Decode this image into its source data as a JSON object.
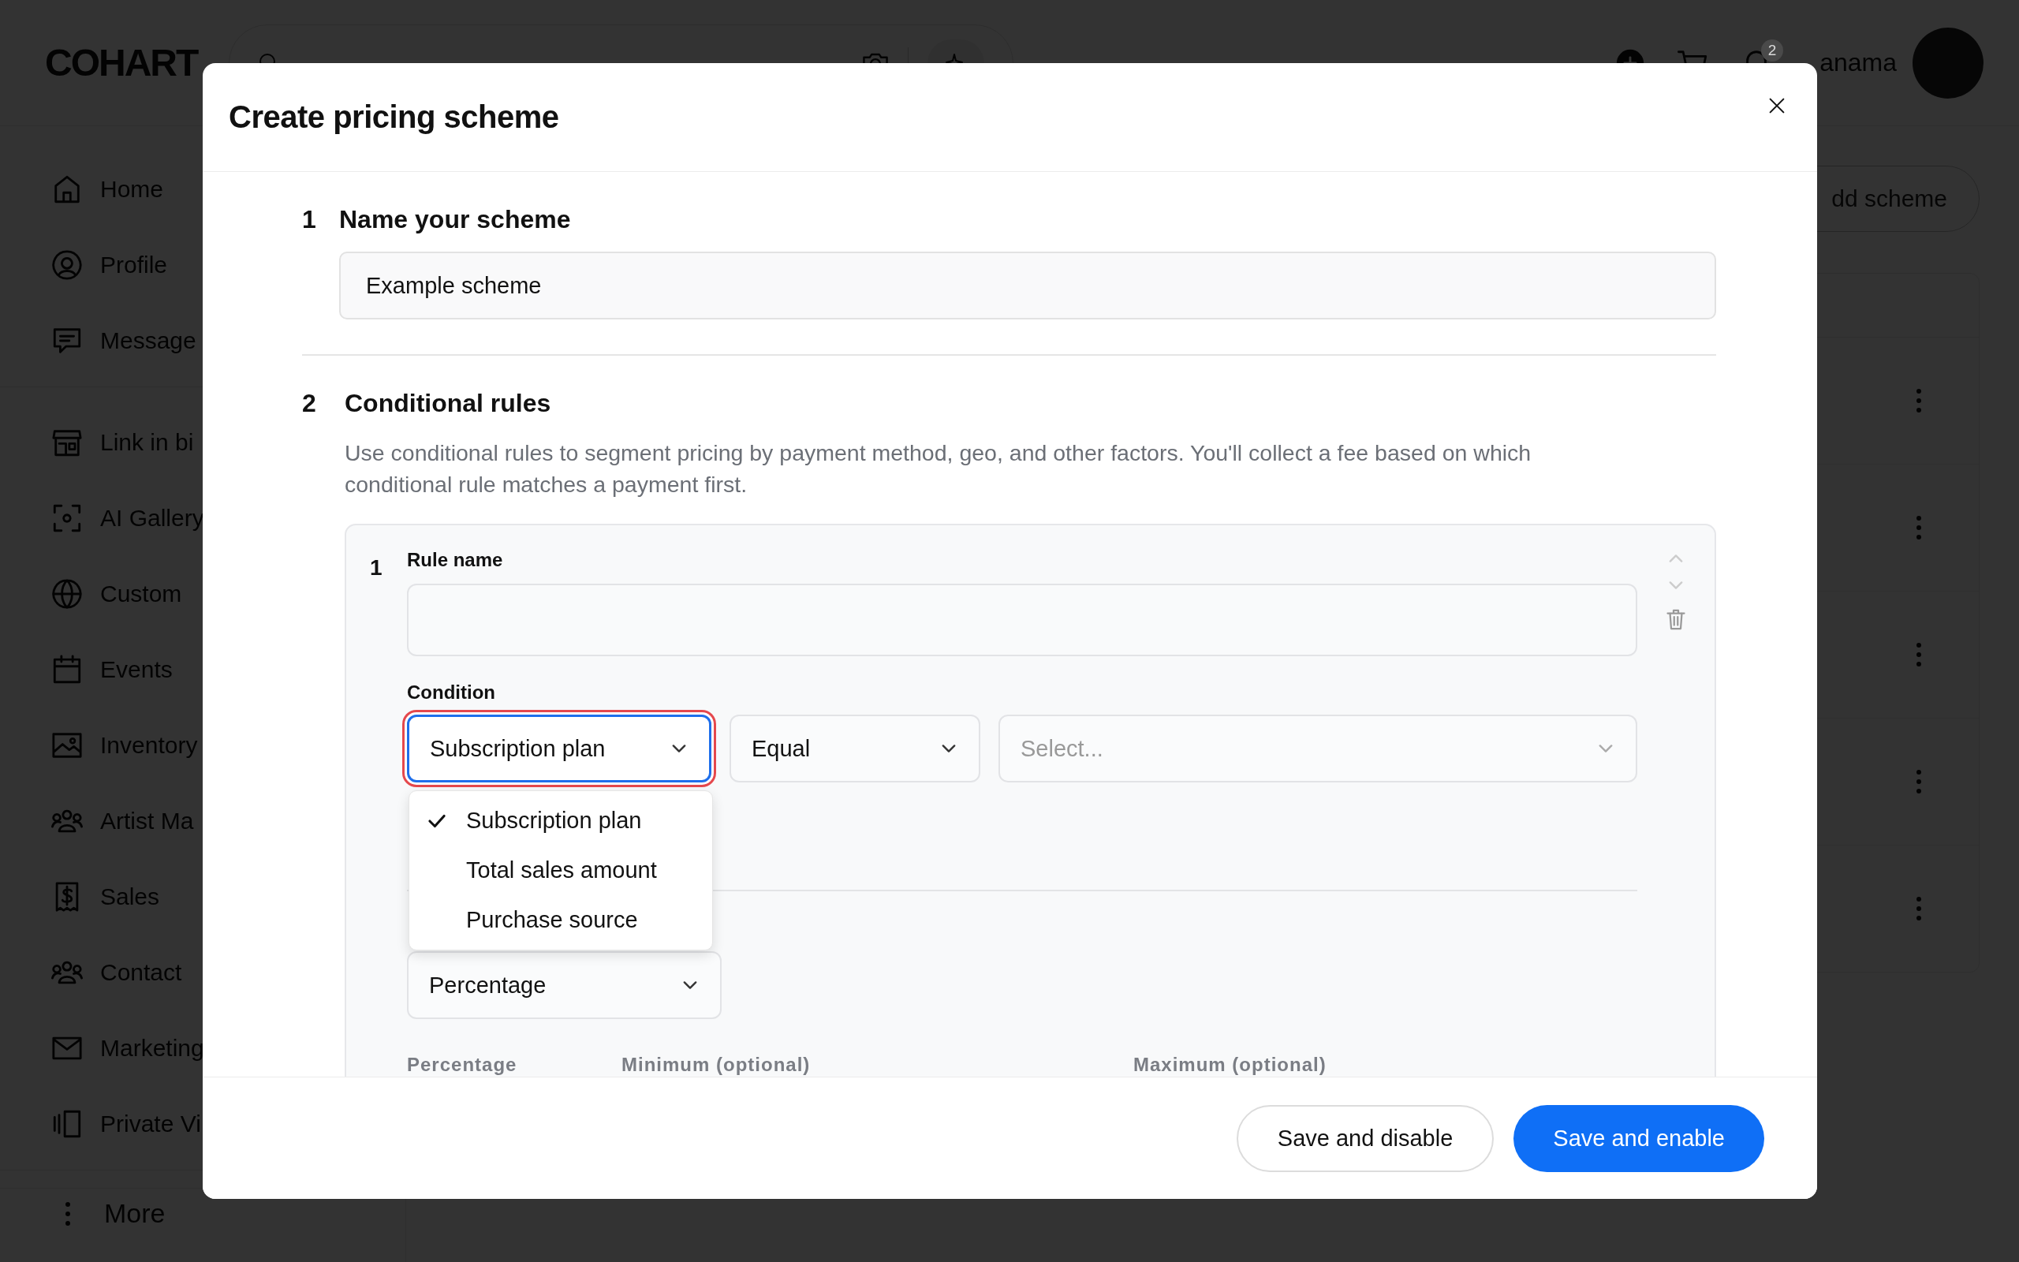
{
  "topbar": {
    "logo": "COHART",
    "notification_count": "2",
    "username": "anama"
  },
  "sidebar": {
    "sections": [
      {
        "items": [
          {
            "label": "Home"
          },
          {
            "label": "Profile"
          },
          {
            "label": "Message"
          }
        ]
      },
      {
        "items": [
          {
            "label": "Link in bi"
          },
          {
            "label": "AI Gallery"
          },
          {
            "label": "Custom"
          },
          {
            "label": "Events"
          },
          {
            "label": "Inventory"
          },
          {
            "label": "Artist Ma"
          },
          {
            "label": "Sales"
          },
          {
            "label": "Contact"
          },
          {
            "label": "Marketing"
          },
          {
            "label": "Private Vi"
          }
        ]
      }
    ],
    "more": "More"
  },
  "main": {
    "add_button": "dd scheme"
  },
  "modal": {
    "title": "Create pricing scheme",
    "name_section": {
      "number": "1",
      "title": "Name your scheme",
      "field": {
        "value": "Example scheme"
      }
    },
    "rules_section": {
      "number": "2",
      "title": "Conditional rules",
      "description": "Use conditional rules to segment pricing by payment method, geo, and other factors. You'll collect a fee based on which conditional rule matches a payment first.",
      "rules": [
        {
          "number": "1",
          "name_label": "Rule name",
          "condition_label": "Condition",
          "field_select": {
            "value": "Subscription plan",
            "focused": true,
            "expanded": true,
            "options": [
              {
                "label": "Subscription plan",
                "selected": true
              },
              {
                "label": "Total sales amount",
                "selected": false
              },
              {
                "label": "Purchase source",
                "selected": false
              }
            ]
          },
          "operator_select": {
            "value": "Equal"
          },
          "target_select": {
            "placeholder": "Select..."
          },
          "fee_select": {
            "value": "Percentage"
          },
          "columns": [
            "Percentage",
            "Minimum (optional)",
            "Maximum (optional)"
          ]
        }
      ]
    },
    "buttons": [
      {
        "label": "Save and disable",
        "kind": "secondary"
      },
      {
        "label": "Save and enable",
        "kind": "primary"
      }
    ]
  }
}
